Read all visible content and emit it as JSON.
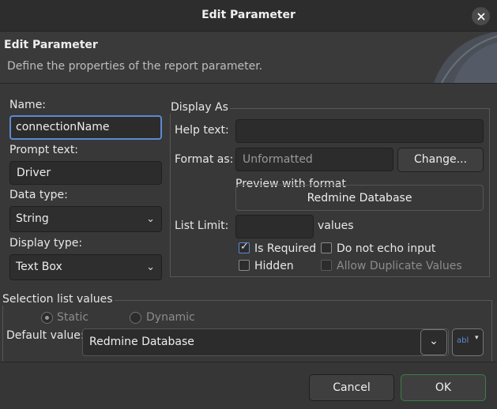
{
  "dialog": {
    "title": "Edit Parameter",
    "header_title": "Edit Parameter",
    "header_description": "Define the properties of the report parameter."
  },
  "form": {
    "name_label": "Name:",
    "name_value": "connectionName",
    "prompt_label": "Prompt text:",
    "prompt_value": "Driver",
    "data_type_label": "Data type:",
    "data_type_value": "String",
    "display_type_label": "Display type:",
    "display_type_value": "Text Box"
  },
  "display_as": {
    "group_title": "Display As",
    "help_text_label": "Help text:",
    "help_text_value": "",
    "format_label": "Format as:",
    "format_value": "Unformatted",
    "change_button": "Change...",
    "preview_title": "Preview with format",
    "preview_value": "Redmine Database",
    "list_limit_label": "List Limit:",
    "list_limit_value": "",
    "values_label": "values",
    "is_required_label": "Is Required",
    "is_required_checked": true,
    "do_not_echo_label": "Do not echo input",
    "hidden_label": "Hidden",
    "allow_duplicate_label": "Allow Duplicate Values"
  },
  "selection": {
    "group_title": "Selection list values",
    "static_label": "Static",
    "dynamic_label": "Dynamic",
    "default_value_label": "Default value:",
    "default_value": "Redmine Database",
    "expression_button_label": "abl"
  },
  "footer": {
    "cancel_label": "Cancel",
    "ok_label": "OK"
  },
  "colors": {
    "accent": "#5d8ad1",
    "ok_border": "#3d7d46"
  }
}
